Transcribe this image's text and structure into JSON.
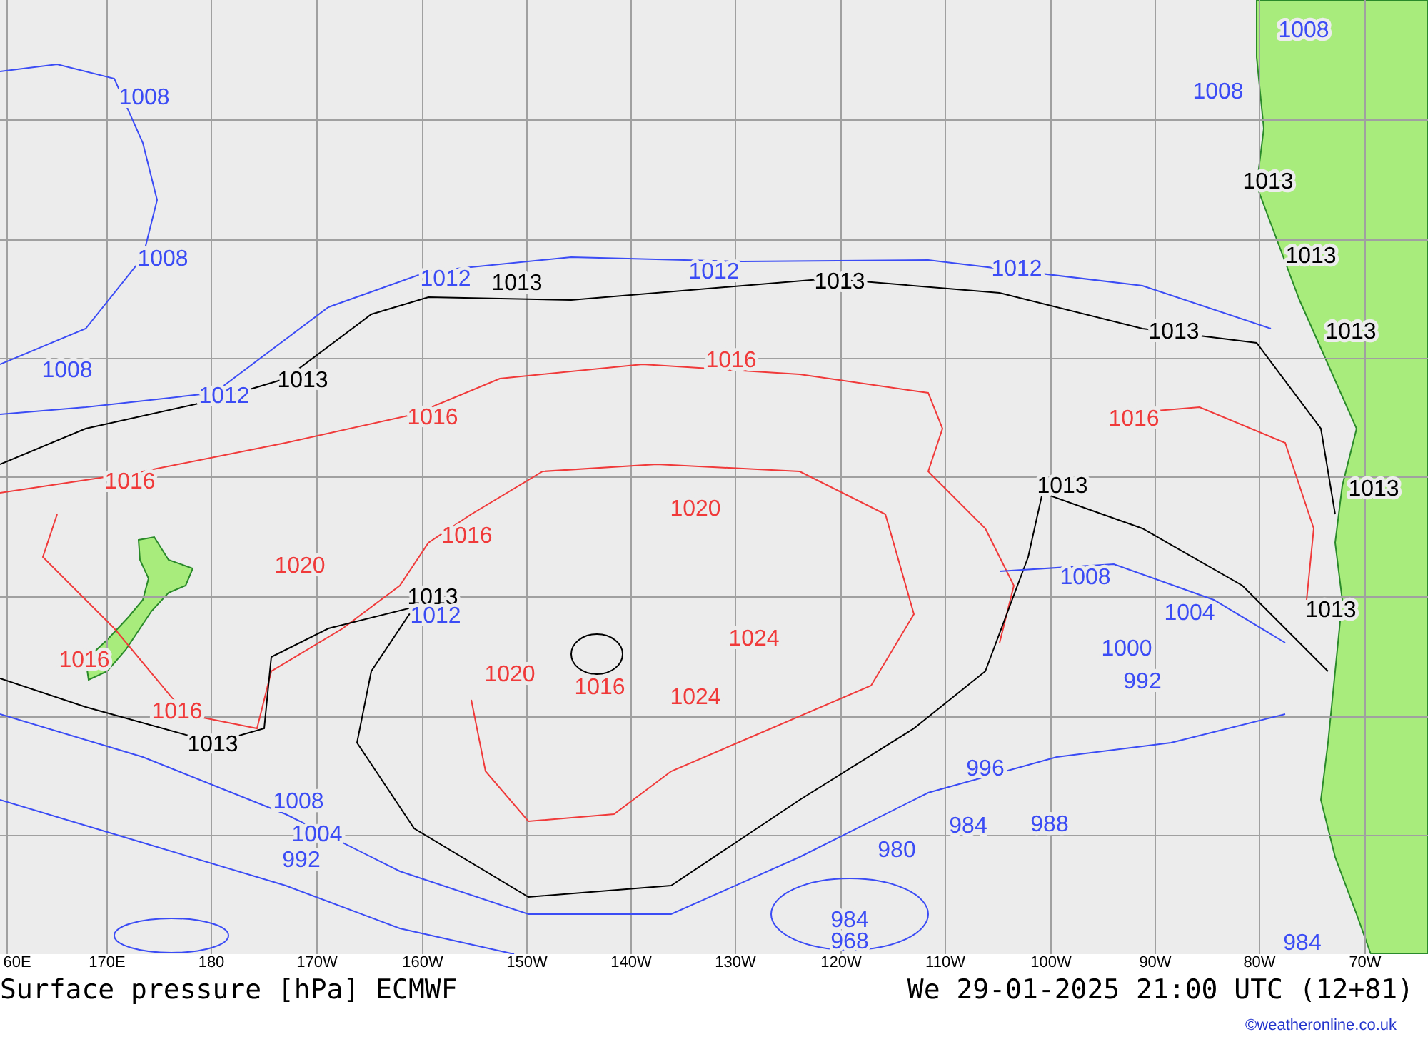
{
  "map": {
    "isobar_labels": [
      {
        "text": "1008",
        "color": "#3b4cf5"
      },
      {
        "text": "1008",
        "color": "#3b4cf5"
      },
      {
        "text": "1008",
        "color": "#3b4cf5"
      },
      {
        "text": "1008",
        "color": "#3b4cf5"
      },
      {
        "text": "1008",
        "color": "#3b4cf5"
      },
      {
        "text": "1012",
        "color": "#3b4cf5"
      },
      {
        "text": "1012",
        "color": "#3b4cf5"
      },
      {
        "text": "1012",
        "color": "#3b4cf5"
      },
      {
        "text": "1012",
        "color": "#3b4cf5"
      },
      {
        "text": "1013",
        "color": "#000000"
      },
      {
        "text": "1013",
        "color": "#000000"
      },
      {
        "text": "1013",
        "color": "#000000"
      },
      {
        "text": "1013",
        "color": "#000000"
      },
      {
        "text": "1013",
        "color": "#000000"
      },
      {
        "text": "1013",
        "color": "#000000"
      },
      {
        "text": "1013",
        "color": "#000000"
      },
      {
        "text": "1013",
        "color": "#000000"
      },
      {
        "text": "1013",
        "color": "#000000"
      },
      {
        "text": "1013",
        "color": "#000000"
      },
      {
        "text": "1013",
        "color": "#000000"
      },
      {
        "text": "1013",
        "color": "#000000"
      },
      {
        "text": "1016",
        "color": "#f03a3a"
      },
      {
        "text": "1016",
        "color": "#f03a3a"
      },
      {
        "text": "1016",
        "color": "#f03a3a"
      },
      {
        "text": "1016",
        "color": "#f03a3a"
      },
      {
        "text": "1016",
        "color": "#f03a3a"
      },
      {
        "text": "1016",
        "color": "#f03a3a"
      },
      {
        "text": "1016",
        "color": "#f03a3a"
      },
      {
        "text": "1016",
        "color": "#f03a3a"
      },
      {
        "text": "1020",
        "color": "#f03a3a"
      },
      {
        "text": "1020",
        "color": "#f03a3a"
      },
      {
        "text": "1020",
        "color": "#f03a3a"
      },
      {
        "text": "1024",
        "color": "#f03a3a"
      },
      {
        "text": "1024",
        "color": "#f03a3a"
      },
      {
        "text": "1012",
        "color": "#3b4cf5"
      },
      {
        "text": "1008",
        "color": "#3b4cf5"
      },
      {
        "text": "1004",
        "color": "#3b4cf5"
      },
      {
        "text": "1000",
        "color": "#3b4cf5"
      },
      {
        "text": "992",
        "color": "#3b4cf5"
      },
      {
        "text": "996",
        "color": "#3b4cf5"
      },
      {
        "text": "984",
        "color": "#3b4cf5"
      },
      {
        "text": "988",
        "color": "#3b4cf5"
      },
      {
        "text": "1008",
        "color": "#3b4cf5"
      },
      {
        "text": "1004",
        "color": "#3b4cf5"
      },
      {
        "text": "992",
        "color": "#3b4cf5"
      },
      {
        "text": "980",
        "color": "#3b4cf5"
      },
      {
        "text": "984",
        "color": "#3b4cf5"
      },
      {
        "text": "968",
        "color": "#3b4cf5"
      },
      {
        "text": "984",
        "color": "#3b4cf5"
      }
    ],
    "longitude_labels": [
      "60E",
      "170E",
      "180",
      "170W",
      "160W",
      "150W",
      "140W",
      "130W",
      "120W",
      "110W",
      "100W",
      "90W",
      "80W",
      "70W"
    ]
  },
  "title": "Surface pressure [hPa] ECMWF",
  "valid_time": "We 29-01-2025 21:00 UTC (12+81)",
  "credit": "©weatheronline.co.uk"
}
